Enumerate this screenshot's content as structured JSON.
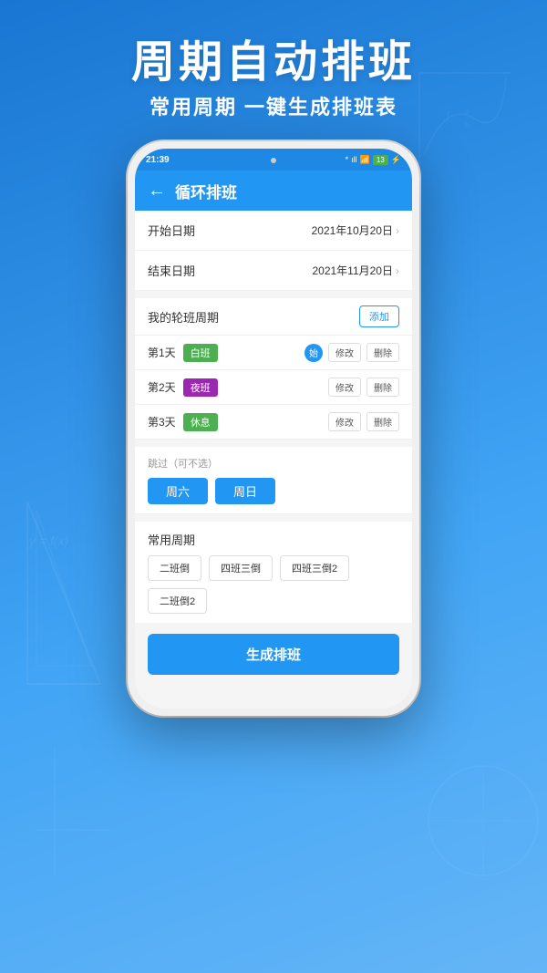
{
  "page": {
    "bg_gradient_start": "#1565C0",
    "bg_gradient_end": "#42A5F5"
  },
  "header": {
    "title": "周期自动排班",
    "subtitle": "常用周期 一键生成排班表"
  },
  "status_bar": {
    "time": "21:39",
    "icons_text": "🔵 ᵴ.ıll 📶 🔋"
  },
  "nav": {
    "back_icon": "←",
    "title": "循环排班"
  },
  "form": {
    "start_date_label": "开始日期",
    "start_date_value": "2021年10月20日",
    "end_date_label": "结束日期",
    "end_date_value": "2021年11月20日"
  },
  "shifts_section": {
    "label": "我的轮班周期",
    "add_btn": "添加",
    "rows": [
      {
        "day": "第1天",
        "name": "白班",
        "color": "white",
        "has_start": true
      },
      {
        "day": "第2天",
        "name": "夜班",
        "color": "night",
        "has_start": false
      },
      {
        "day": "第3天",
        "name": "休息",
        "color": "rest",
        "has_start": false
      }
    ],
    "modify_btn": "修改",
    "delete_btn": "删除",
    "start_label": "始"
  },
  "skip_section": {
    "label": "跳过（可不选）",
    "buttons": [
      "周六",
      "周日"
    ]
  },
  "common_section": {
    "label": "常用周期",
    "presets": [
      "二班倒",
      "四班三倒",
      "四班三倒2",
      "二班倒2"
    ]
  },
  "generate_btn": "生成排班"
}
